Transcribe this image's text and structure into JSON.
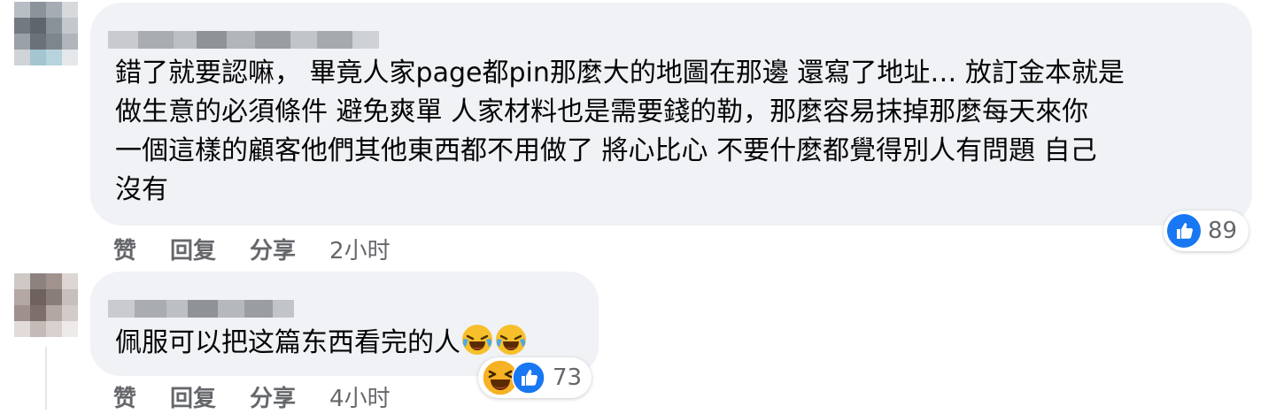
{
  "comments": [
    {
      "text_lines": [
        "錯了就要認嘛， 畢竟人家page都pin那麼大的地圖在那邊 還寫了地址… 放訂金本就是",
        "做生意的必須條件 避免爽單 人家材料也是需要錢的勒，那麼容易抹掉那麼每天來你",
        "一個這樣的顧客他們其他東西都不用做了 將心比心 不要什麼都覺得別人有問題 自己",
        "沒有"
      ],
      "reactions": {
        "types": [
          "like-icon"
        ],
        "count": "89"
      },
      "actions": {
        "like": "赞",
        "reply": "回复",
        "share": "分享",
        "time": "2小时"
      }
    },
    {
      "text": "佩服可以把这篇东西看完的人",
      "inline_emojis": [
        "rolling-laughing-emoji",
        "rolling-laughing-emoji"
      ],
      "reactions": {
        "types": [
          "haha-icon",
          "like-icon"
        ],
        "count": "73"
      },
      "actions": {
        "like": "赞",
        "reply": "回复",
        "share": "分享",
        "time": "4小时"
      }
    }
  ],
  "colors": {
    "bubble": "#f0f2f5",
    "secondary_text": "#65676b",
    "like_blue": "#1877f2",
    "haha_yellow": "#f7b125"
  }
}
